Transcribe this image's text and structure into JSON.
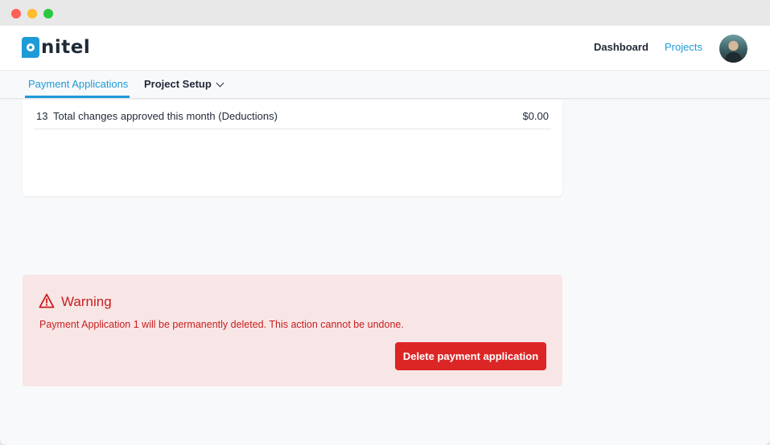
{
  "header": {
    "logo_text": "nitel",
    "nav": {
      "dashboard": "Dashboard",
      "projects": "Projects"
    }
  },
  "tabs": {
    "payment_applications": "Payment Applications",
    "project_setup": "Project Setup"
  },
  "table": {
    "rows": [
      {
        "number": "13",
        "label": "Total changes approved this month (Deductions)",
        "value": "$0.00"
      }
    ]
  },
  "warning": {
    "title": "Warning",
    "message": "Payment Application 1 will be permanently deleted. This action cannot be undone.",
    "button_label": "Delete payment application"
  },
  "colors": {
    "accent": "#1d9bd7",
    "danger": "#dc2626",
    "danger_text": "#c81e1e",
    "warning_bg": "#f8e6e6"
  },
  "icons": {
    "warning": "warning-triangle-icon",
    "chevron": "chevron-down-icon"
  }
}
